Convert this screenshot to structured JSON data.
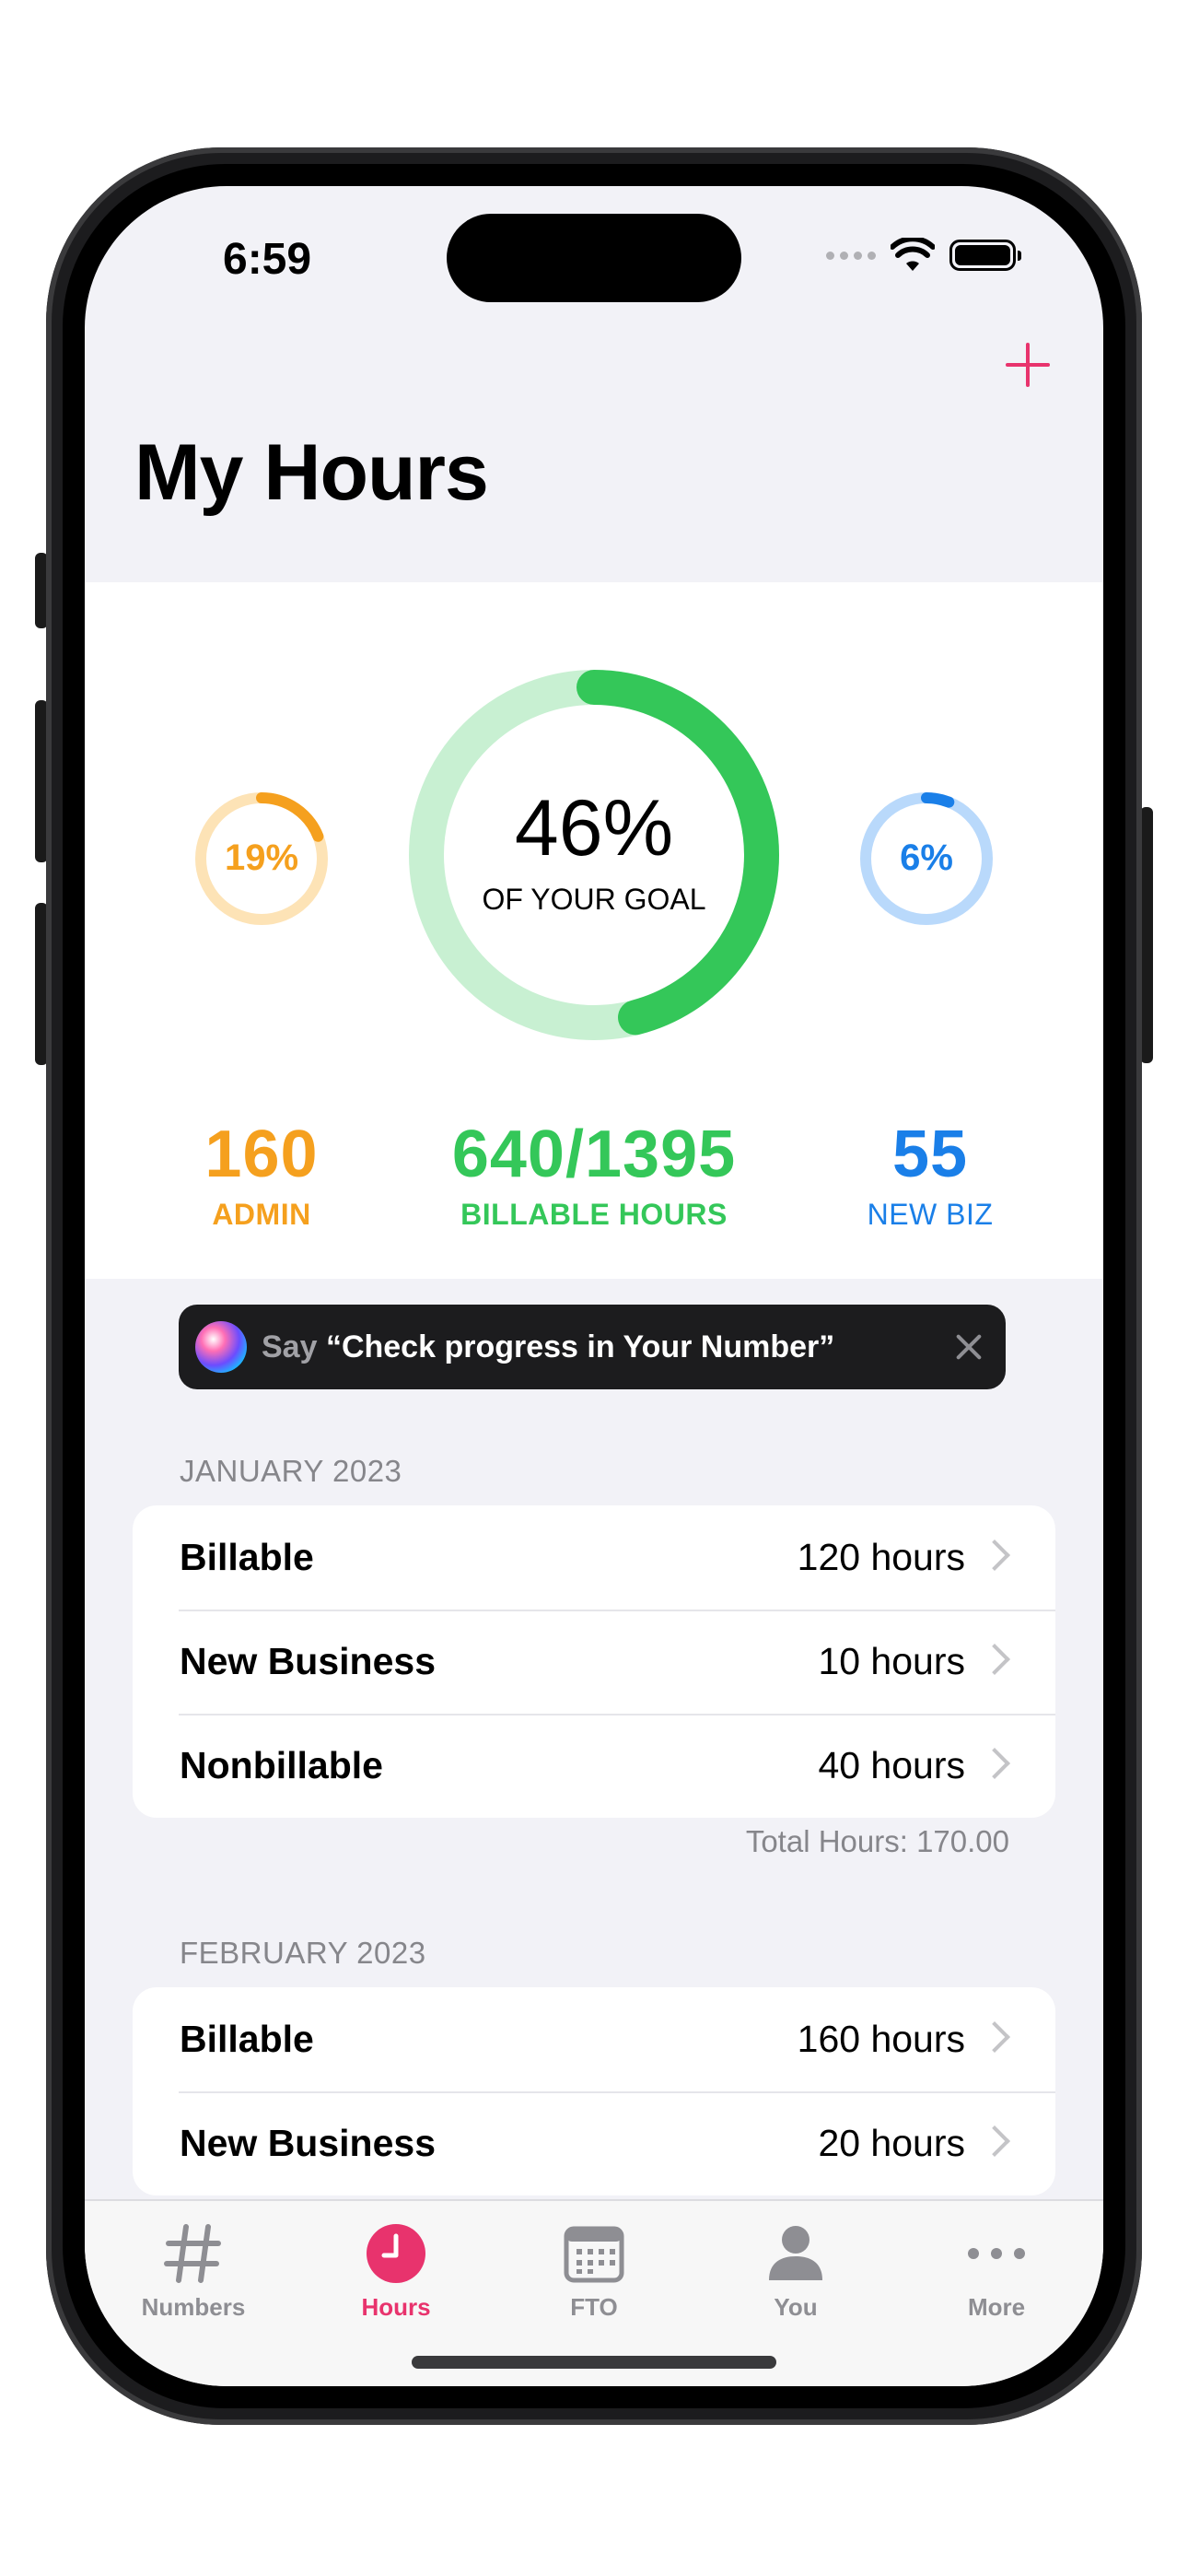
{
  "status": {
    "time": "6:59"
  },
  "header": {
    "title": "My Hours"
  },
  "summary": {
    "admin": {
      "percent_text": "19%",
      "progress": 0.19,
      "value": "160",
      "label": "ADMIN"
    },
    "billable": {
      "percent_text": "46%",
      "subtitle": "OF YOUR GOAL",
      "progress": 0.46,
      "value": "640/1395",
      "label": "BILLABLE HOURS"
    },
    "newbiz": {
      "percent_text": "6%",
      "progress": 0.06,
      "value": "55",
      "label": "NEW BIZ"
    }
  },
  "colors": {
    "accent": "#e8336d",
    "admin": "#f5a01e",
    "admin_track": "#fde3b6",
    "billable": "#34c759",
    "billable_track": "#c8f0d2",
    "newbiz": "#1a7fe8",
    "newbiz_track": "#b9d9fb"
  },
  "siri": {
    "say": "Say",
    "phrase": "“Check progress in Your Number”"
  },
  "sections": [
    {
      "header": "JANUARY 2023",
      "rows": [
        {
          "label": "Billable",
          "value": "120 hours"
        },
        {
          "label": "New Business",
          "value": "10 hours"
        },
        {
          "label": "Nonbillable",
          "value": "40 hours"
        }
      ],
      "total": "Total Hours: 170.00"
    },
    {
      "header": "FEBRUARY 2023",
      "rows": [
        {
          "label": "Billable",
          "value": "160 hours"
        },
        {
          "label": "New Business",
          "value": "20 hours"
        }
      ]
    }
  ],
  "tabs": [
    {
      "label": "Numbers",
      "icon": "hash-icon",
      "active": false
    },
    {
      "label": "Hours",
      "icon": "clock-icon",
      "active": true
    },
    {
      "label": "FTO",
      "icon": "calendar-icon",
      "active": false
    },
    {
      "label": "You",
      "icon": "person-icon",
      "active": false
    },
    {
      "label": "More",
      "icon": "ellipsis-icon",
      "active": false
    }
  ]
}
